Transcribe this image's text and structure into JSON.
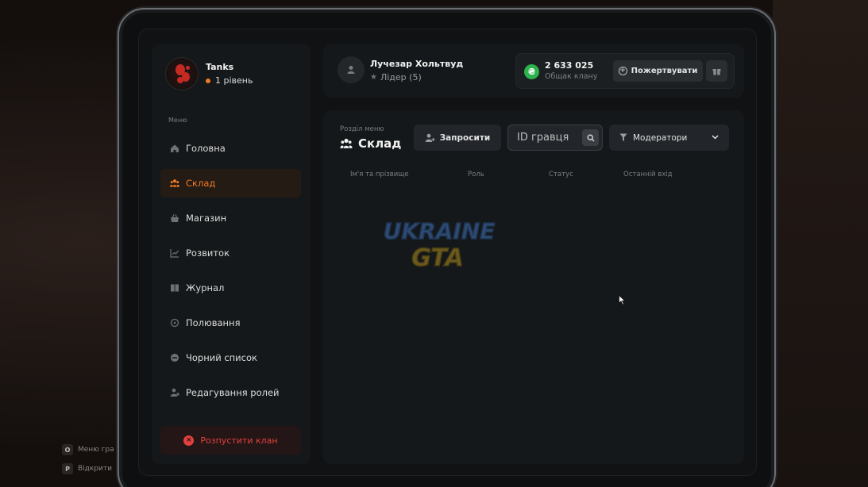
{
  "background_hints": [
    {
      "key": "O",
      "label": "Меню гра"
    },
    {
      "key": "P",
      "label": "Відкрити"
    }
  ],
  "clan": {
    "name": "Tanks",
    "level": "1 рівень"
  },
  "sidebar": {
    "caption": "Меню",
    "items": [
      {
        "label": "Головна",
        "icon": "home-icon"
      },
      {
        "label": "Склад",
        "icon": "users-icon",
        "active": true
      },
      {
        "label": "Магазин",
        "icon": "basket-icon"
      },
      {
        "label": "Розвиток",
        "icon": "chart-icon"
      },
      {
        "label": "Журнал",
        "icon": "book-icon"
      },
      {
        "label": "Полювання",
        "icon": "crosshair-icon"
      },
      {
        "label": "Чорний список",
        "icon": "block-icon"
      },
      {
        "label": "Редагування ролей",
        "icon": "user-edit-icon"
      }
    ],
    "disband_label": "Розпустити клан"
  },
  "header": {
    "leader_name": "Лучезар Хольтвуд",
    "leader_role": "Лідер (5)",
    "wallet": {
      "currency_symbol": "₴",
      "amount": "2 633 025",
      "caption": "Общак клану"
    },
    "donate_label": "Пожертвувати"
  },
  "main": {
    "section_caption": "Розділ меню",
    "section_title": "Склад",
    "invite_label": "Запросити",
    "search_placeholder": "ID гравця",
    "filter_selected": "Модератори",
    "columns": [
      "Ім'я та прізвище",
      "Роль",
      "Статус",
      "Останній вхід"
    ]
  },
  "watermark": {
    "line1": "UKRAINE",
    "line2": "GTA"
  },
  "colors": {
    "accent": "#f07a23",
    "danger": "#e2403e",
    "money": "#2bb24c",
    "panel": "#15181a"
  }
}
